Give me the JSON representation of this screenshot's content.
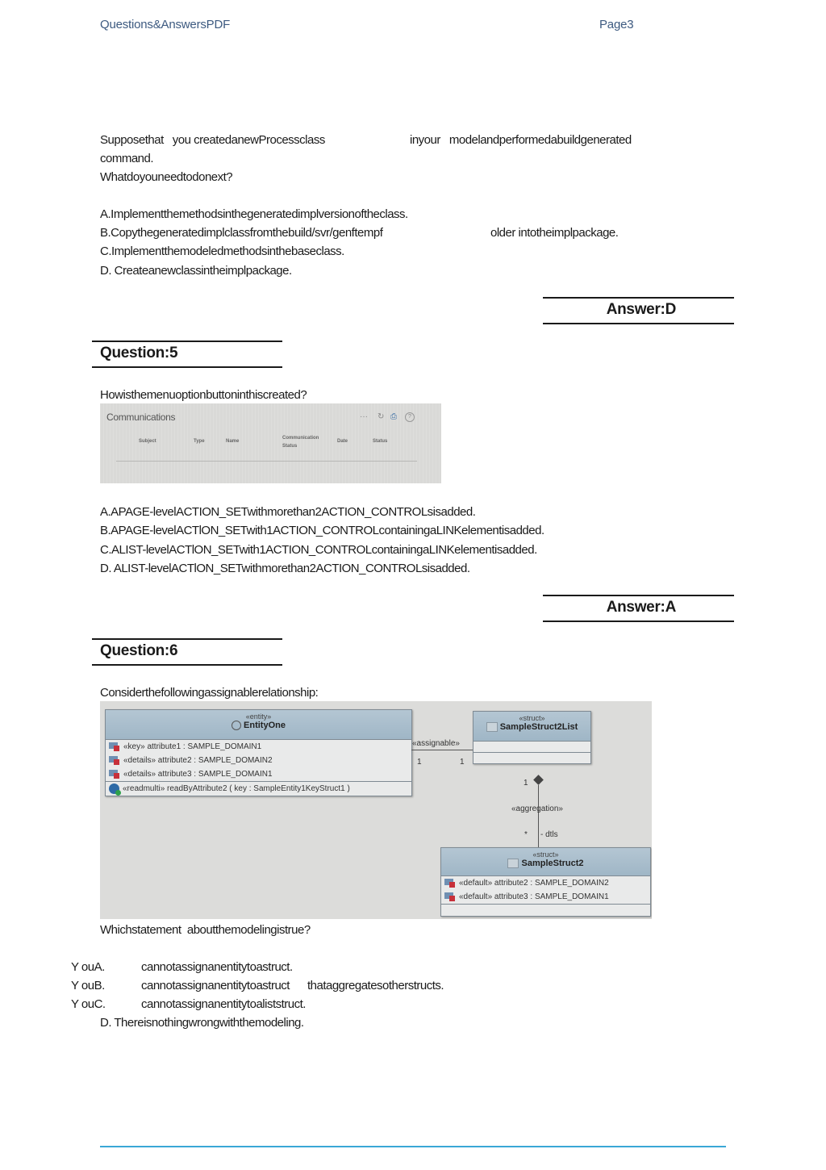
{
  "header": {
    "left": "Questions&AnswersPDF",
    "right": "Page3"
  },
  "question4_tail": {
    "stem_line1_a": "Supposethat   you createdanewProcessclass",
    "stem_line1_b": "inyour   modelandperformedabuildgenerated",
    "stem_line2": "command.",
    "stem_line3": "Whatdoyouneedtodonext?",
    "options": [
      "A.Implementthemethodsinthegeneratedimplversionoftheclass.",
      "B.Copythegeneratedimplclassfromthebuild/svr/genftempf",
      "C.Implementthemodeledmethodsinthebaseclass.",
      "D. Createanewclassintheimplpackage."
    ],
    "option_b_tail": "older intotheimplpackage.",
    "answer": "Answer:D"
  },
  "question5": {
    "title": "Question:5",
    "stem": "Howisthemenuoptionbuttoninthiscreated?",
    "screenshot": {
      "title": "Communications",
      "columns": [
        "Subject",
        "Type",
        "Name",
        "Communication",
        "Date",
        "Status"
      ],
      "column_sub": "Status",
      "icons": [
        "more-icon",
        "refresh-icon",
        "print-icon",
        "help-icon"
      ],
      "icon_glyphs": [
        "···",
        "↻",
        "⎙",
        "?"
      ]
    },
    "options": [
      "A.APAGE-levelACTION_SETwithmorethan2ACTION_CONTROLsisadded.",
      "B.APAGE-levelACTlON_SETwith1ACTION_CONTROLcontainingaLINKelementisadded.",
      "C.ALIST-levelACTlON_SETwith1ACTION_CONTROLcontainingaLINKelementisadded.",
      "D. ALIST-levelACTlON_SETwithmorethan2ACTION_CONTROLsisadded."
    ],
    "answer": "Answer:A"
  },
  "question6": {
    "title": "Question:6",
    "stem": "Considerthefollowingassignablerelationship:",
    "diagram": {
      "entity": {
        "stereotype": "«entity»",
        "name": "EntityOne",
        "attributes": [
          "«key» attribute1 : SAMPLE_DOMAIN1",
          "«details» attribute2 : SAMPLE_DOMAIN2",
          "«details» attribute3 : SAMPLE_DOMAIN1"
        ],
        "methods": [
          "«readmulti» readByAttribute2 ( key : SampleEntity1KeyStruct1 )"
        ]
      },
      "list_struct": {
        "stereotype": "«struct»",
        "name": "SampleStruct2List"
      },
      "struct": {
        "stereotype": "«struct»",
        "name": "SampleStruct2",
        "attributes": [
          "«default» attribute2 : SAMPLE_DOMAIN2",
          "«default» attribute3 : SAMPLE_DOMAIN1"
        ]
      },
      "assoc_label": "«assignable»",
      "assoc_mult_left": "1",
      "assoc_mult_right": "1",
      "agg_mult_top": "1",
      "agg_label": "«aggregation»",
      "agg_mult_bottom": "*",
      "agg_role": "- dtls"
    },
    "question": "Whichstatement  aboutthemodelingistrue?",
    "options": [
      {
        "prefix": "Y ouA.",
        "text": "cannotassignanentitytoastruct."
      },
      {
        "prefix": "Y ouB.",
        "text": "cannotassignanentitytoastruct      thataggregatesotherstructs."
      },
      {
        "prefix": "Y ouC.",
        "text": "cannotassignanentitytoaliststruct."
      },
      {
        "prefix": "",
        "text": "D. Thereisnothingwrongwiththemodeling."
      }
    ]
  }
}
